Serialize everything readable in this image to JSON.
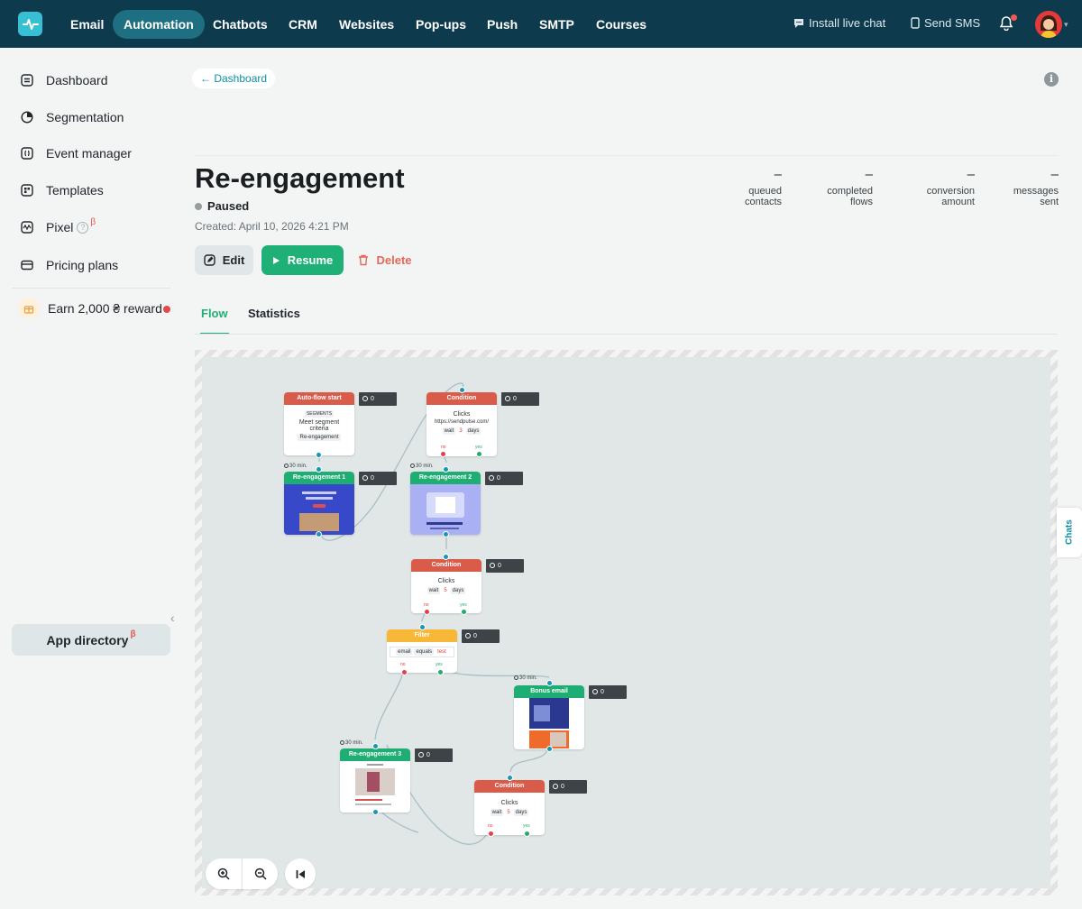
{
  "topbar": {
    "logo_icon": "sendpulse-pulse-icon",
    "nav": [
      "Email",
      "Automation",
      "Chatbots",
      "CRM",
      "Websites",
      "Pop-ups",
      "Push",
      "SMTP",
      "Courses"
    ],
    "install_chat": "Install live chat",
    "send_sms": "Send SMS"
  },
  "sidebar": {
    "items": [
      "Dashboard",
      "Segmentation",
      "Event manager",
      "Templates",
      "Pixel",
      "Pricing plans"
    ],
    "beta_mark": "β",
    "help_mark": "?",
    "reward": "Earn 2,000 ₴ reward",
    "app_directory": "App directory"
  },
  "header": {
    "back": "← Dashboard",
    "title": "Re-engagement",
    "status": "Paused",
    "created": "Created: April 10, 2026 4:21 PM",
    "info_mark": "i",
    "stats": [
      {
        "value": "–",
        "l1": "queued",
        "l2": "contacts"
      },
      {
        "value": "–",
        "l1": "completed",
        "l2": "flows"
      },
      {
        "value": "–",
        "l1": "conversion",
        "l2": "amount"
      },
      {
        "value": "–",
        "l1": "messages",
        "l2": "sent"
      }
    ],
    "buttons": {
      "edit": "Edit",
      "resume": "Resume",
      "delete": "Delete"
    },
    "tabs": [
      "Flow",
      "Statistics"
    ]
  },
  "flow": {
    "counter": "0",
    "timer": "30 min.",
    "no": "no",
    "yes": "yes",
    "start": {
      "title": "Auto-flow start",
      "tag": "SEGMENTS",
      "text": "Meet segment criteria",
      "segment": "Re-engagement"
    },
    "cond1": {
      "title": "Condition",
      "text": "Clicks",
      "url": "https://sendpulse.com/",
      "wait": "wait",
      "n": "3",
      "unit": "days"
    },
    "email1": {
      "title": "Re-engagement 1"
    },
    "email2": {
      "title": "Re-engagement 2"
    },
    "cond2": {
      "title": "Condition",
      "text": "Clicks",
      "wait": "wait",
      "n": "5",
      "unit": "days"
    },
    "filter": {
      "title": "Filter",
      "field": "email",
      "op": "equals",
      "value": "test"
    },
    "bonus": {
      "title": "Bonus email"
    },
    "email3": {
      "title": "Re-engagement 3"
    },
    "cond3": {
      "title": "Condition",
      "text": "Clicks",
      "wait": "wait",
      "n": "5",
      "unit": "days"
    }
  },
  "chats_tab": "Chats",
  "colors": {
    "topbar": "#0d3a4d",
    "accent": "#1eb076",
    "condition": "#d95b4a",
    "email": "#1eae73",
    "filter": "#f7b737",
    "link": "#0c8fa6"
  }
}
